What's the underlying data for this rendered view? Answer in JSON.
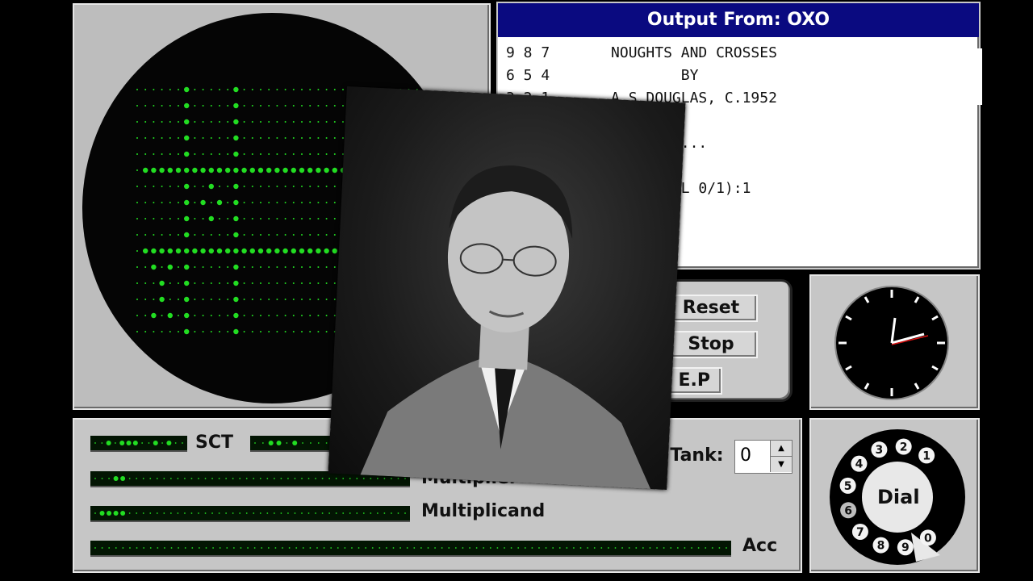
{
  "output": {
    "title": "Output From: OXO",
    "lines": [
      "9 8 7       NOUGHTS AND CROSSES",
      "6 5 4               BY",
      "3 2 1       A S DOUGLAS, C.1952",
      "",
      "                  IT...",
      "",
      "                (DIAL 0/1):1"
    ]
  },
  "controls": {
    "reset_label": "Reset",
    "stop_label": "Stop",
    "ep_label": "e E.P"
  },
  "registers": {
    "sct_label": "SCT",
    "multiplier_label": "Multiplier",
    "multiplicand_label": "Multiplicand",
    "acc_label": "Acc",
    "tank_label": "g Tank:",
    "tank_value": "0"
  },
  "dial": {
    "center_label": "Dial",
    "numbers": [
      "1",
      "2",
      "3",
      "4",
      "5",
      "6",
      "7",
      "8",
      "9",
      "0"
    ]
  },
  "colors": {
    "phosphor": "#22dd22",
    "title_bar": "#0a0a80",
    "clock_hand": "#dd1111"
  }
}
